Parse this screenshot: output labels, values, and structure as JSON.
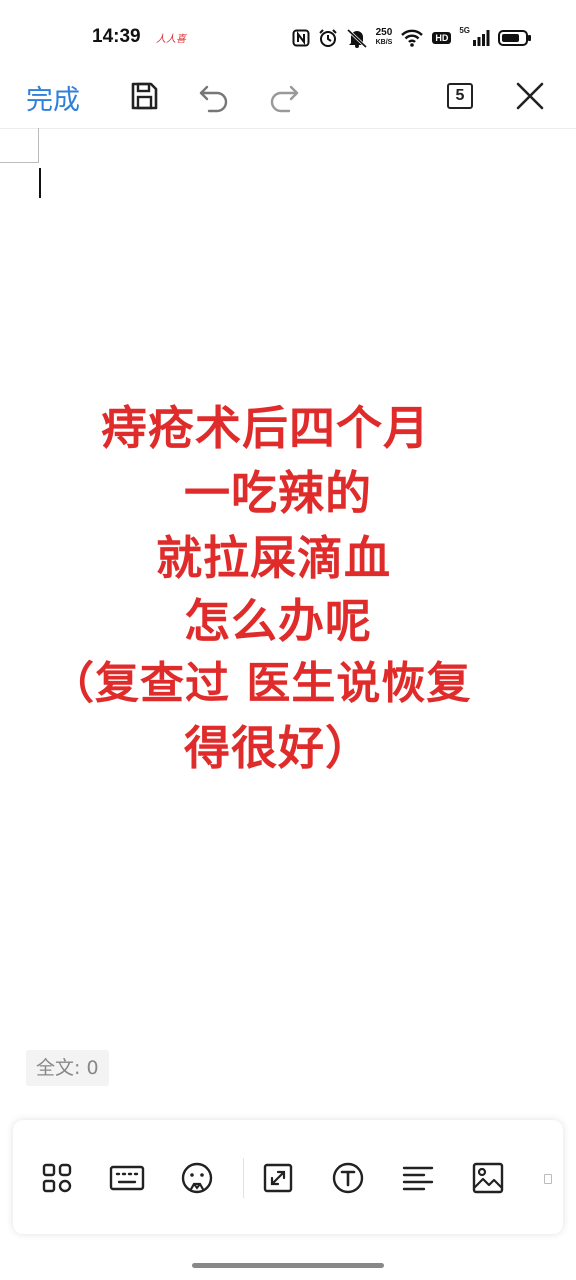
{
  "status_bar": {
    "time": "14:39",
    "net_speed_value": "250",
    "net_speed_unit": "KB/S",
    "hd_label": "HD",
    "signal_label": "5G"
  },
  "toolbar": {
    "done_label": "完成",
    "page_count": "5"
  },
  "image": {
    "lines": [
      "痔疮术后四个月",
      "一吃辣的",
      "就拉屎滴血",
      "怎么办呢",
      "（复查过 医生说恢复",
      "得很好）"
    ],
    "text_color": "#e02b2b"
  },
  "word_count": "全文: 0",
  "bottom_toolbar": {
    "items": [
      "apps-icon",
      "keyboard-icon",
      "sticker-icon",
      "expand-icon",
      "text-style-icon",
      "align-left-icon",
      "image-icon",
      "more-icon"
    ]
  },
  "colors": {
    "accent": "#2f7fdb",
    "icon": "#222222"
  }
}
